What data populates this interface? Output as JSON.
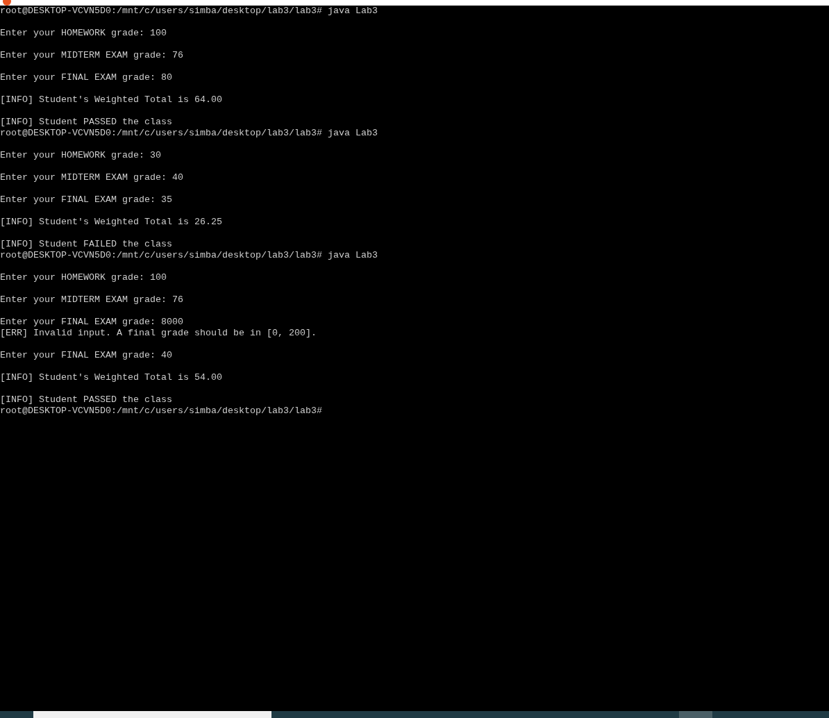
{
  "terminal": {
    "paragraphs": [
      [
        "root@DESKTOP-VCVN5D0:/mnt/c/users/simba/desktop/lab3/lab3# java Lab3"
      ],
      [
        "Enter your HOMEWORK grade: 100"
      ],
      [
        "Enter your MIDTERM EXAM grade: 76"
      ],
      [
        "Enter your FINAL EXAM grade: 80"
      ],
      [
        "[INFO] Student's Weighted Total is 64.00"
      ],
      [
        "[INFO] Student PASSED the class",
        "root@DESKTOP-VCVN5D0:/mnt/c/users/simba/desktop/lab3/lab3# java Lab3"
      ],
      [
        "Enter your HOMEWORK grade: 30"
      ],
      [
        "Enter your MIDTERM EXAM grade: 40"
      ],
      [
        "Enter your FINAL EXAM grade: 35"
      ],
      [
        "[INFO] Student's Weighted Total is 26.25"
      ],
      [
        "[INFO] Student FAILED the class",
        "root@DESKTOP-VCVN5D0:/mnt/c/users/simba/desktop/lab3/lab3# java Lab3"
      ],
      [
        "Enter your HOMEWORK grade: 100"
      ],
      [
        "Enter your MIDTERM EXAM grade: 76"
      ],
      [
        "Enter your FINAL EXAM grade: 8000",
        "[ERR] Invalid input. A final grade should be in [0, 200]."
      ],
      [
        "Enter your FINAL EXAM grade: 40"
      ],
      [
        "[INFO] Student's Weighted Total is 54.00"
      ],
      [
        "[INFO] Student PASSED the class",
        "root@DESKTOP-VCVN5D0:/mnt/c/users/simba/desktop/lab3/lab3#"
      ]
    ]
  }
}
